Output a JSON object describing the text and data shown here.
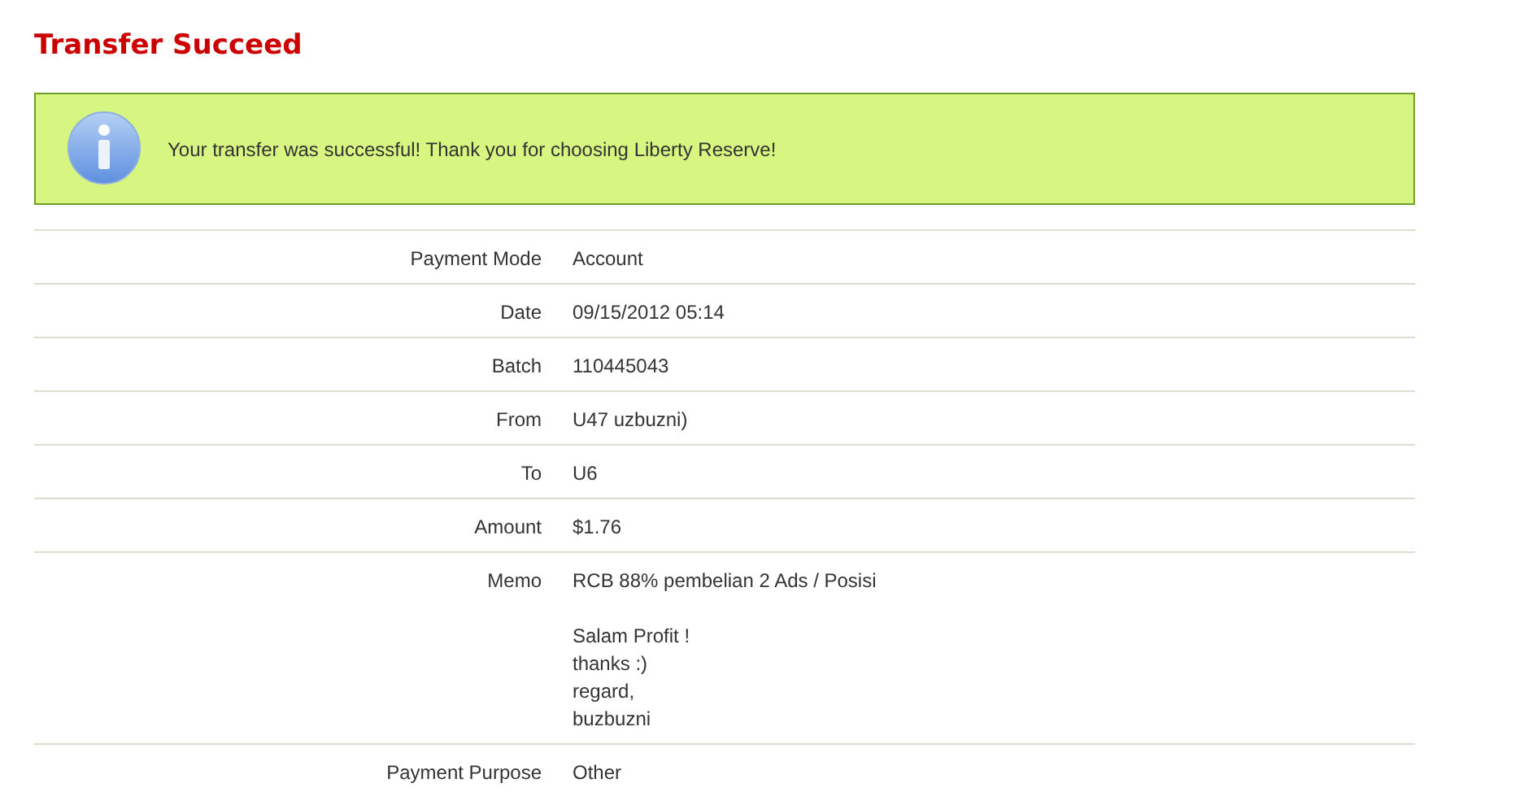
{
  "title": "Transfer Succeed",
  "banner": {
    "message": "Your transfer was successful! Thank you for choosing Liberty Reserve!"
  },
  "details": [
    {
      "label": "Payment Mode",
      "paragraphs": [
        [
          "Account"
        ]
      ]
    },
    {
      "label": "Date",
      "paragraphs": [
        [
          "09/15/2012 05:14"
        ]
      ]
    },
    {
      "label": "Batch",
      "paragraphs": [
        [
          "110445043"
        ]
      ]
    },
    {
      "label": "From",
      "paragraphs": [
        [
          "U47 uzbuzni)"
        ]
      ]
    },
    {
      "label": "To",
      "paragraphs": [
        [
          "U6"
        ]
      ]
    },
    {
      "label": "Amount",
      "paragraphs": [
        [
          "$1.76"
        ]
      ]
    },
    {
      "label": "Memo",
      "paragraphs": [
        [
          "RCB 88% pembelian 2 Ads / Posisi"
        ],
        [
          "Salam Profit !",
          "thanks :)",
          "regard,",
          "buzbuzni"
        ]
      ]
    },
    {
      "label": "Payment Purpose",
      "paragraphs": [
        [
          "Other"
        ]
      ]
    }
  ]
}
